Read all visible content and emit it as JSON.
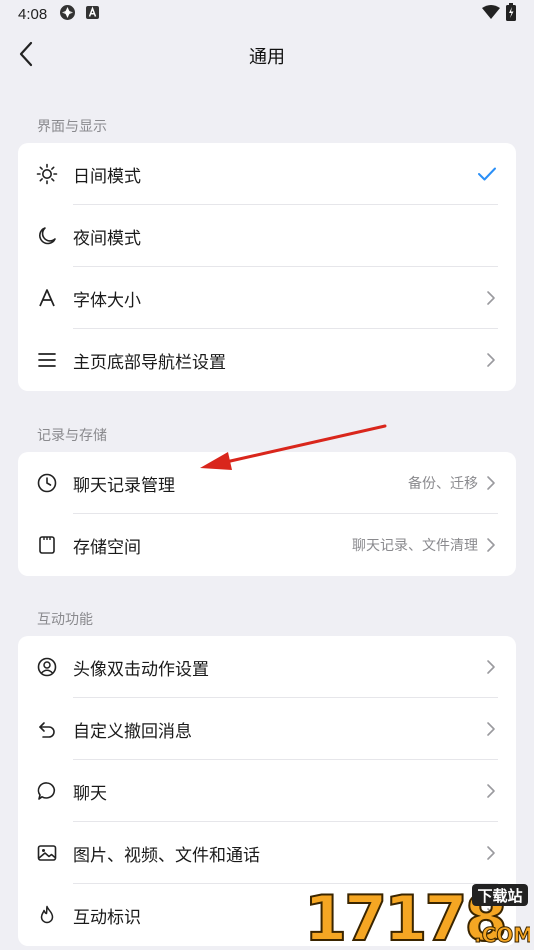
{
  "status_bar": {
    "time": "4:08"
  },
  "header": {
    "title": "通用"
  },
  "sections": [
    {
      "title": "界面与显示",
      "items": [
        {
          "label": "日间模式",
          "icon": "sun-icon",
          "trailing": "check"
        },
        {
          "label": "夜间模式",
          "icon": "moon-icon",
          "trailing": "none"
        },
        {
          "label": "字体大小",
          "icon": "font-icon",
          "trailing": "chevron"
        },
        {
          "label": "主页底部导航栏设置",
          "icon": "menu-icon",
          "trailing": "chevron"
        }
      ]
    },
    {
      "title": "记录与存储",
      "items": [
        {
          "label": "聊天记录管理",
          "icon": "clock-icon",
          "detail": "备份、迁移",
          "trailing": "chevron"
        },
        {
          "label": "存储空间",
          "icon": "sd-card-icon",
          "detail": "聊天记录、文件清理",
          "trailing": "chevron"
        }
      ]
    },
    {
      "title": "互动功能",
      "items": [
        {
          "label": "头像双击动作设置",
          "icon": "avatar-icon",
          "trailing": "chevron"
        },
        {
          "label": "自定义撤回消息",
          "icon": "undo-icon",
          "trailing": "chevron"
        },
        {
          "label": "聊天",
          "icon": "chat-bubble-icon",
          "trailing": "chevron"
        },
        {
          "label": "图片、视频、文件和通话",
          "icon": "image-icon",
          "trailing": "chevron"
        },
        {
          "label": "互动标识",
          "icon": "flame-icon",
          "trailing": "chevron"
        }
      ]
    }
  ],
  "watermark": {
    "number": "17178",
    "badge": "下载站",
    "domain": ".COM"
  },
  "colors": {
    "accent": "#2a8ff7",
    "annotation_arrow": "#d9261c",
    "background": "#efeff4",
    "card": "#ffffff"
  }
}
